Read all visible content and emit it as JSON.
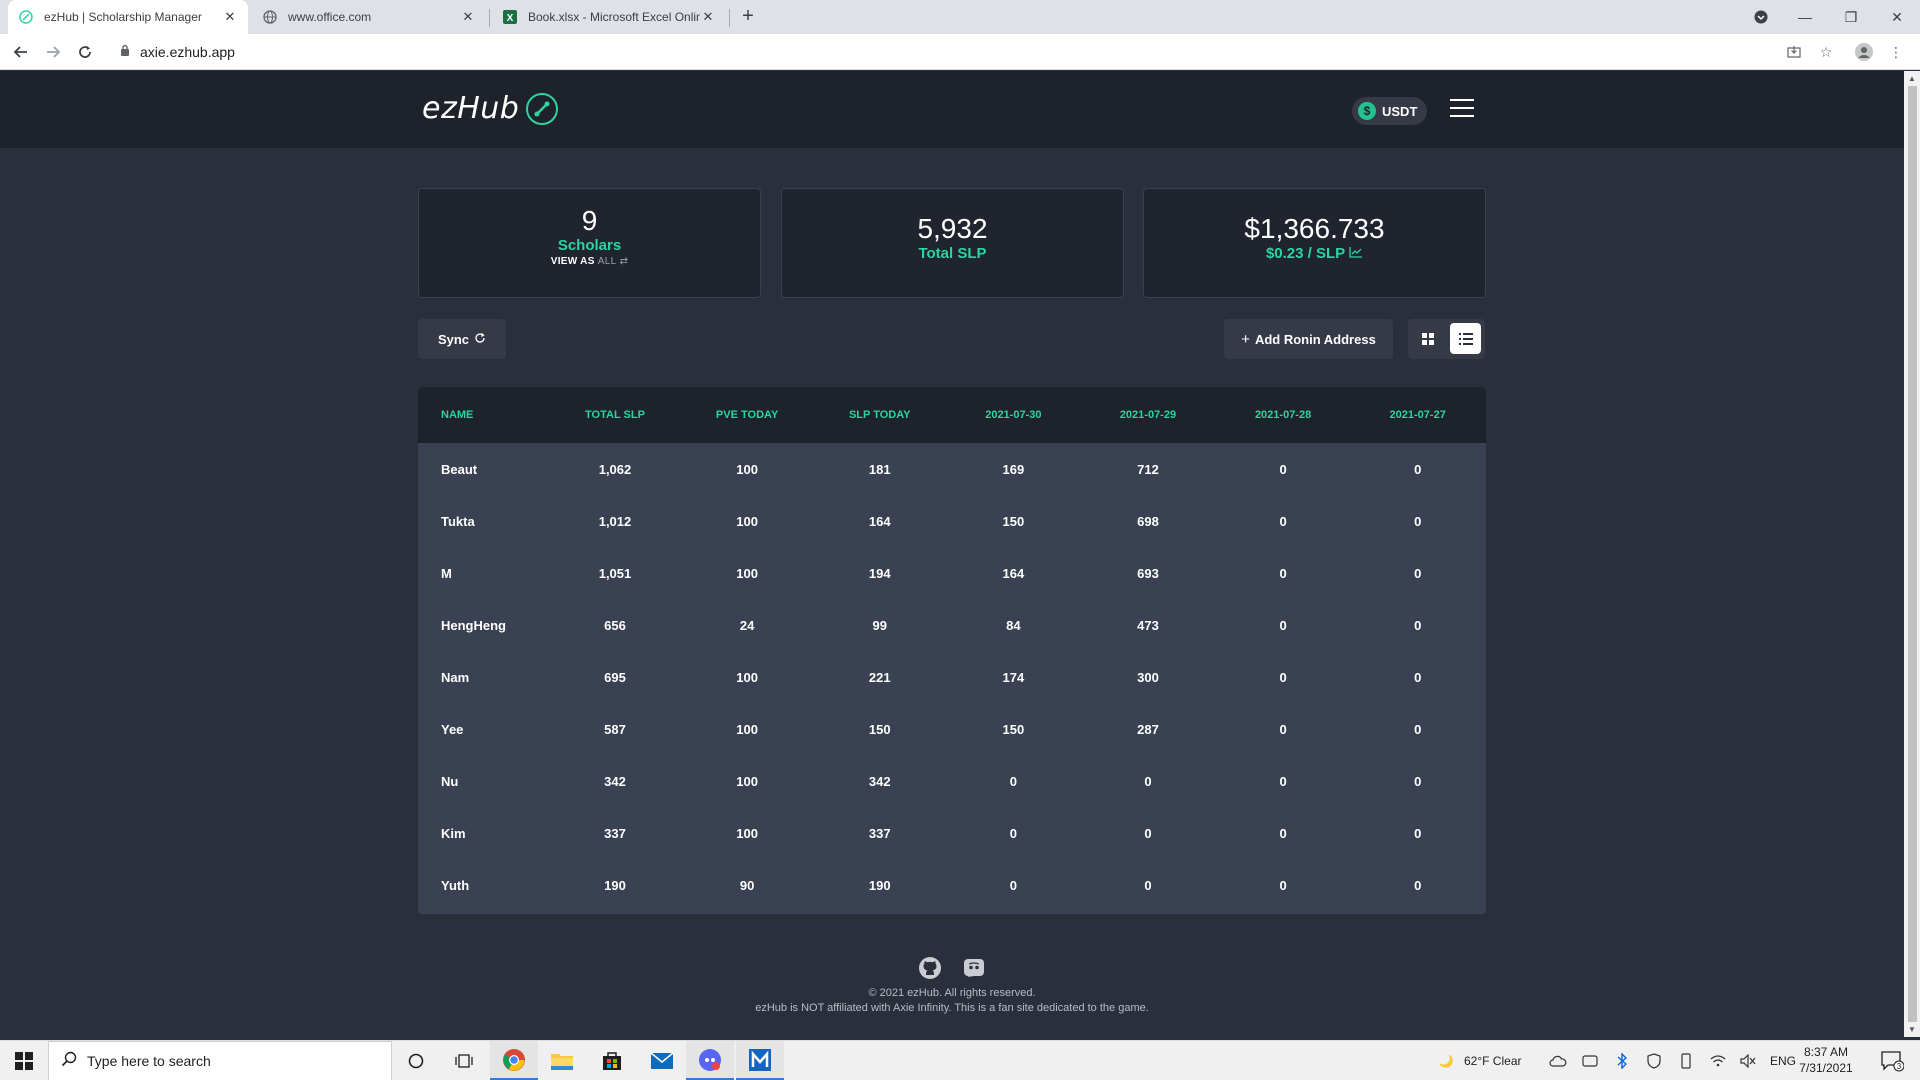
{
  "browser": {
    "tabs": [
      {
        "title": "ezHub | Scholarship Manager",
        "active": true
      },
      {
        "title": "www.office.com",
        "active": false
      },
      {
        "title": "Book.xlsx - Microsoft Excel Online",
        "active": false
      }
    ],
    "url": "axie.ezhub.app"
  },
  "header": {
    "logo_text": "ezHub",
    "currency_label": "USDT",
    "currency_symbol": "$"
  },
  "stats": {
    "scholars_count": "9",
    "scholars_label": "Scholars",
    "view_as_label": "VIEW AS",
    "view_as_value": "ALL",
    "total_slp_value": "5,932",
    "total_slp_label": "Total SLP",
    "total_usd_value": "$1,366.733",
    "slp_price_label": "$0.23 / SLP"
  },
  "toolbar": {
    "sync_label": "Sync",
    "add_label": "Add Ronin Address"
  },
  "table": {
    "headers": [
      "NAME",
      "TOTAL SLP",
      "PVE TODAY",
      "SLP TODAY",
      "2021-07-30",
      "2021-07-29",
      "2021-07-28",
      "2021-07-27"
    ],
    "rows": [
      [
        "Beaut",
        "1,062",
        "100",
        "181",
        "169",
        "712",
        "0",
        "0"
      ],
      [
        "Tukta",
        "1,012",
        "100",
        "164",
        "150",
        "698",
        "0",
        "0"
      ],
      [
        "M",
        "1,051",
        "100",
        "194",
        "164",
        "693",
        "0",
        "0"
      ],
      [
        "HengHeng",
        "656",
        "24",
        "99",
        "84",
        "473",
        "0",
        "0"
      ],
      [
        "Nam",
        "695",
        "100",
        "221",
        "174",
        "300",
        "0",
        "0"
      ],
      [
        "Yee",
        "587",
        "100",
        "150",
        "150",
        "287",
        "0",
        "0"
      ],
      [
        "Nu",
        "342",
        "100",
        "342",
        "0",
        "0",
        "0",
        "0"
      ],
      [
        "Kim",
        "337",
        "100",
        "337",
        "0",
        "0",
        "0",
        "0"
      ],
      [
        "Yuth",
        "190",
        "90",
        "190",
        "0",
        "0",
        "0",
        "0"
      ]
    ]
  },
  "footer": {
    "copyright": "© 2021 ezHub. All rights reserved.",
    "disclaimer": "ezHub is NOT affiliated with Axie Infinity. This is a fan site dedicated to the game.",
    "icons": [
      "github-icon",
      "discord-icon"
    ]
  },
  "taskbar": {
    "search_placeholder": "Type here to search",
    "weather": "62°F  Clear",
    "language": "ENG",
    "time": "8:37 AM",
    "date": "7/31/2021",
    "notification_count": "3"
  },
  "colors": {
    "accent": "#2dd4a0",
    "background": "#2a2f3b",
    "header_bg": "#1e222b",
    "table_bg": "#3a4152"
  }
}
